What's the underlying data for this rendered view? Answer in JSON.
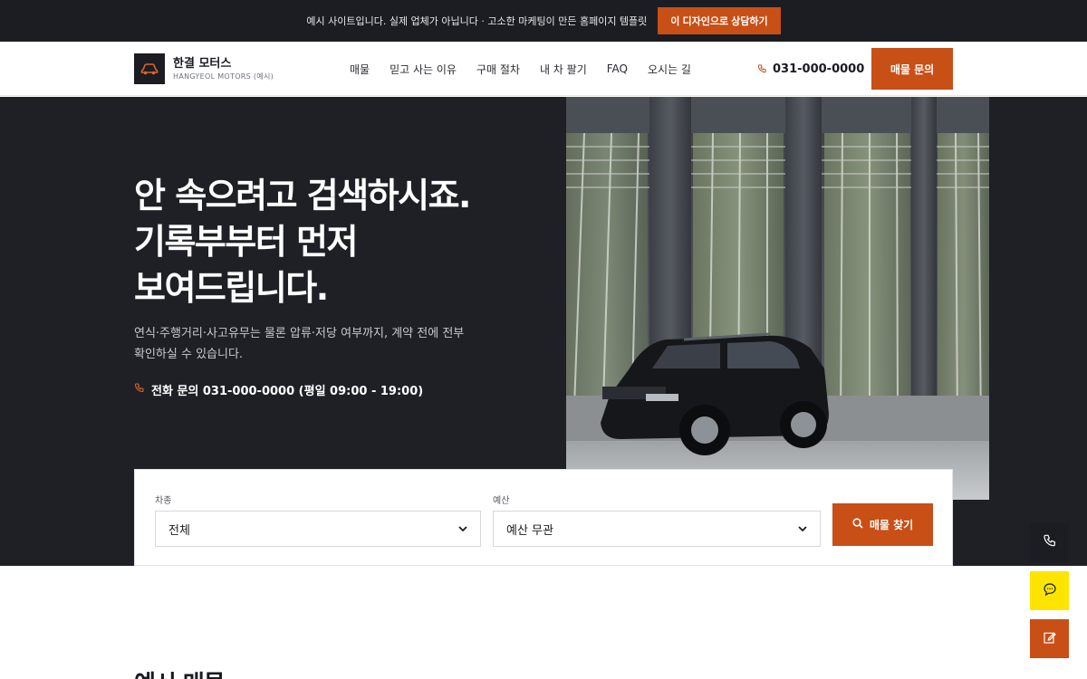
{
  "notice": {
    "text": "예시 사이트입니다. 실제 업체가 아닙니다 · 고소한 마케팅이 만든 홈페이지 템플릿",
    "cta": "이 디자인으로 상담하기"
  },
  "brand": {
    "name": "한결 모터스",
    "sub": "HANGYEOL MOTORS (예시)"
  },
  "nav": [
    "매물",
    "믿고 사는 이유",
    "구매 절차",
    "내 차 팔기",
    "FAQ",
    "오시는 길"
  ],
  "header": {
    "phone": "031-000-0000",
    "cta": "매물 문의"
  },
  "hero": {
    "title_lines": [
      "안 속으려고 검색하시죠.",
      "기록부부터 먼저",
      "보여드립니다."
    ],
    "desc": "연식·주행거리·사고유무는 물론 압류·저당 여부까지, 계약 전에 전부 확인하실 수 있습니다.",
    "phone": "전화 문의 031-000-0000 (평일 09:00 - 19:00)"
  },
  "search": {
    "type_label": "차종",
    "type_value": "전체",
    "budget_label": "예산",
    "budget_value": "예산 무관",
    "button": "매물 찾기"
  },
  "section": {
    "title": "예시 매물"
  },
  "colors": {
    "accent": "#c84f16",
    "dark": "#1f2026",
    "kakao": "#fee500"
  },
  "float_icons": [
    "phone-icon",
    "chat-icon",
    "edit-icon"
  ]
}
